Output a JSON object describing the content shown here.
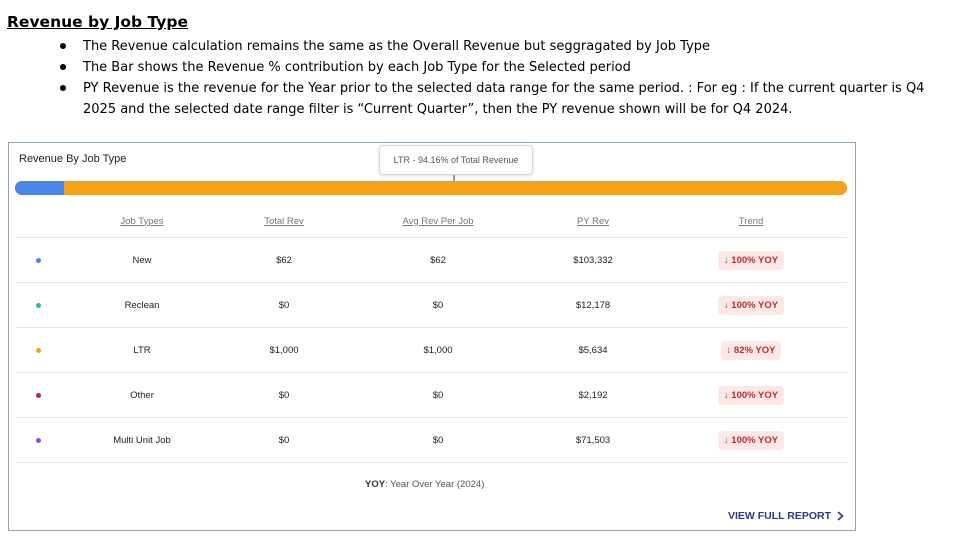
{
  "document": {
    "title": "Revenue by Job Type",
    "bullets": [
      "The Revenue calculation remains the same as the Overall Revenue but seggragated by Job Type",
      "The Bar shows the Revenue % contribution by each Job Type for the Selected period",
      "PY Revenue is the revenue for the Year prior to the selected data range for the same period. : For eg : If the current quarter is Q4 2025 and the selected date range filter is “Current Quarter”, then the PY revenue shown will be for Q4 2024."
    ]
  },
  "card": {
    "title": "Revenue By Job Type",
    "tooltip": "LTR - 94.16% of Total Revenue",
    "bar_segments": [
      {
        "label": "New",
        "fraction": 0.0584,
        "color": "#4a86e8"
      },
      {
        "label": "LTR",
        "fraction": 0.9416,
        "color": "#f3a21b"
      }
    ],
    "columns": {
      "job_types": "Job Types",
      "total_rev": "Total Rev",
      "avg_rev": "Avg Rev Per Job",
      "py_rev": "PY Rev",
      "trend": "Trend"
    },
    "rows": [
      {
        "job_type": "New",
        "total_rev": "$62",
        "avg_rev": "$62",
        "py_rev": "$103,332",
        "trend": "100% YOY",
        "dot_color": "#4a86e8"
      },
      {
        "job_type": "Reclean",
        "total_rev": "$0",
        "avg_rev": "$0",
        "py_rev": "$12,178",
        "trend": "100% YOY",
        "dot_color": "#2bb5a0"
      },
      {
        "job_type": "LTR",
        "total_rev": "$1,000",
        "avg_rev": "$1,000",
        "py_rev": "$5,634",
        "trend": "82% YOY",
        "dot_color": "#f3a21b"
      },
      {
        "job_type": "Other",
        "total_rev": "$0",
        "avg_rev": "$0",
        "py_rev": "$2,192",
        "trend": "100% YOY",
        "dot_color": "#b0245a"
      },
      {
        "job_type": "Multi Unit Job",
        "total_rev": "$0",
        "avg_rev": "$0",
        "py_rev": "$71,503",
        "trend": "100% YOY",
        "dot_color": "#8a4fd8"
      }
    ],
    "footnote_key": "YOY",
    "footnote_text": ": Year Over Year (2024)",
    "view_report": "VIEW FULL REPORT"
  }
}
